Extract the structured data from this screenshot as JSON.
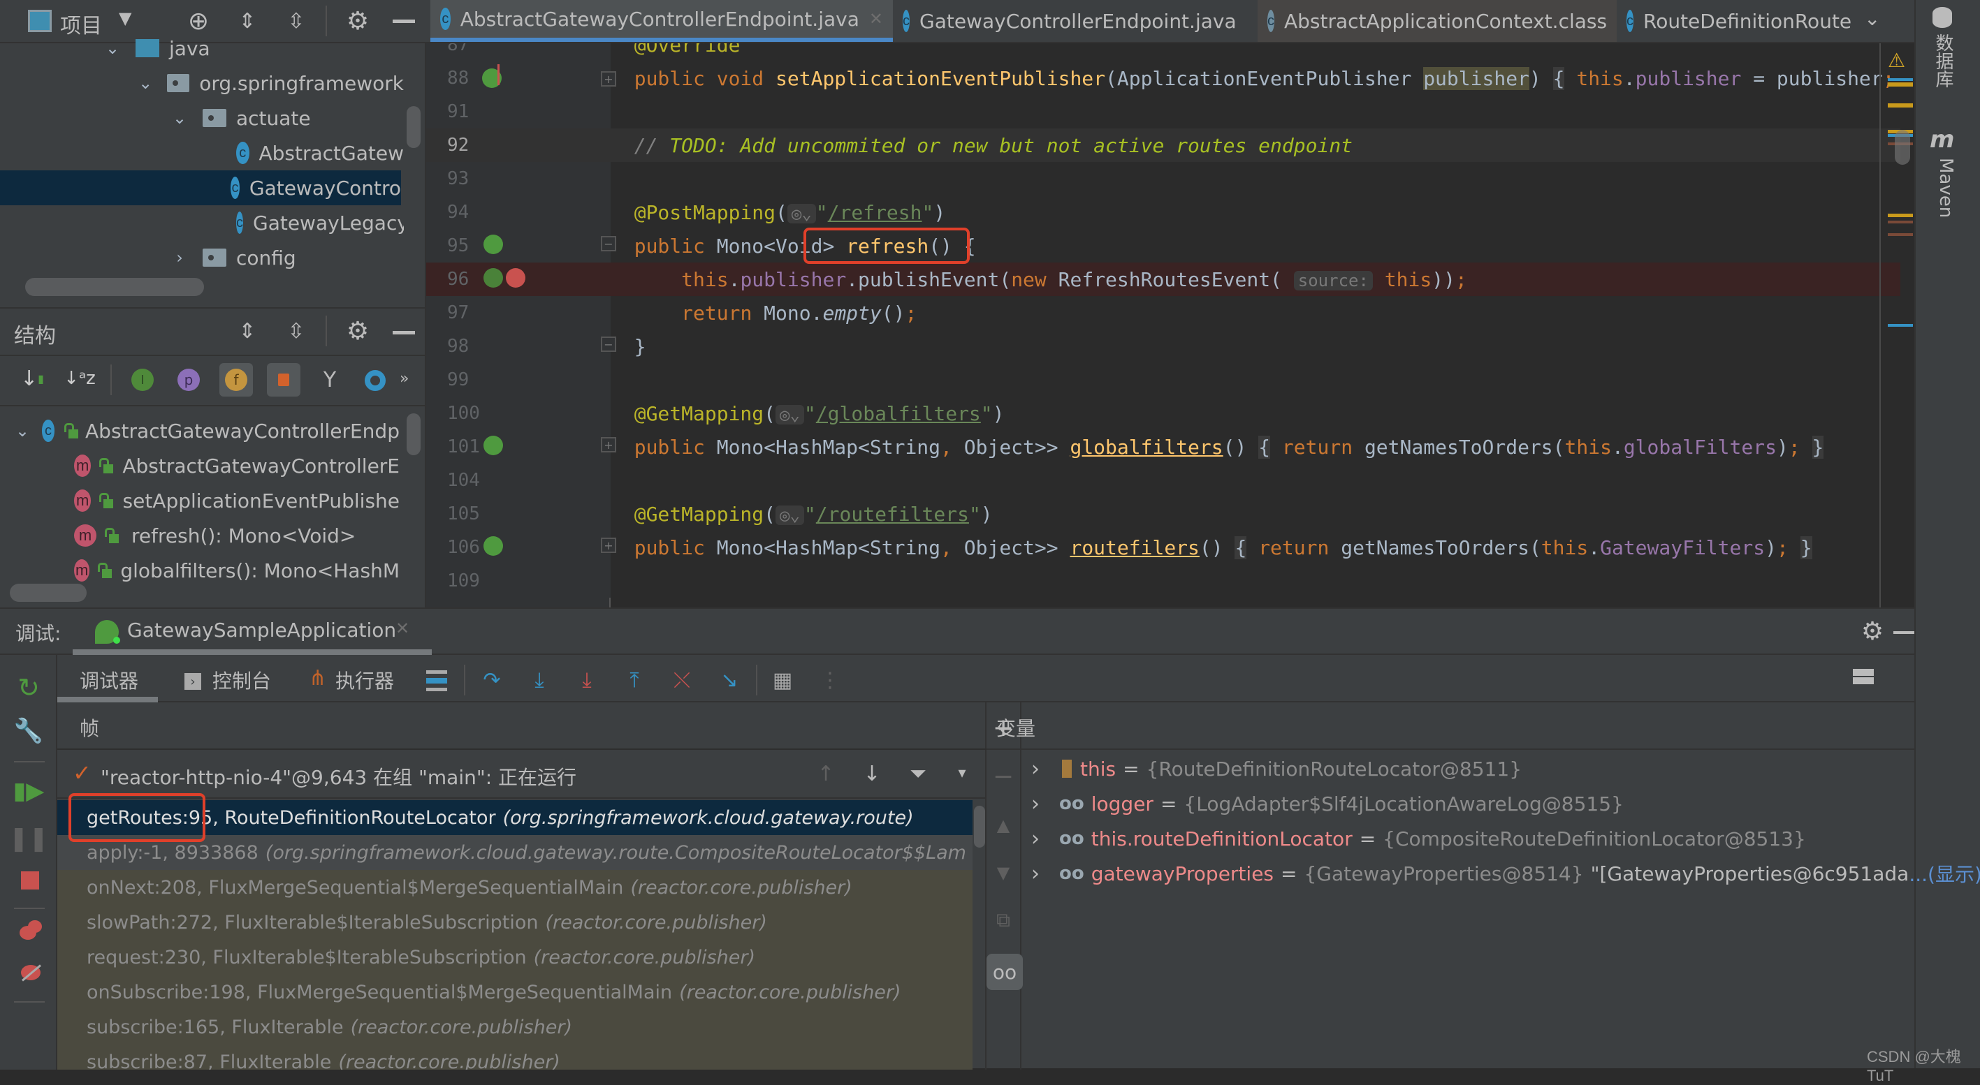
{
  "project_panel": {
    "title": "项目",
    "tree": [
      {
        "label": "java",
        "type": "source-folder",
        "expanded": true
      },
      {
        "label": "org.springframework",
        "type": "package",
        "expanded": true
      },
      {
        "label": "actuate",
        "type": "package",
        "expanded": true
      },
      {
        "label": "AbstractGatew",
        "type": "class"
      },
      {
        "label": "GatewayContro",
        "type": "class",
        "selected": true
      },
      {
        "label": "GatewayLegacy",
        "type": "class"
      },
      {
        "label": "config",
        "type": "package",
        "expanded": false
      }
    ]
  },
  "structure_panel": {
    "title": "结构",
    "toolbar_more": "»",
    "root": "AbstractGatewayControllerEndp",
    "members": [
      "AbstractGatewayControllerE",
      "setApplicationEventPublishe",
      "refresh(): Mono<Void>",
      "globalfilters(): Mono<HashM"
    ]
  },
  "tabs": [
    {
      "label": "AbstractGatewayControllerEndpoint.java",
      "active": true,
      "closable": true
    },
    {
      "label": "GatewayControllerEndpoint.java",
      "active": false,
      "closable": true
    },
    {
      "label": "AbstractApplicationContext.class",
      "active": false,
      "closable": true
    },
    {
      "label": "RouteDefinitionRoute",
      "active": false,
      "closable": false
    }
  ],
  "editor": {
    "lines": [
      {
        "num": "87",
        "html": "<span class='ann'>@Override</span>"
      },
      {
        "num": "88",
        "html": "<span class='kw'>public void </span><span class='fn'>setApplicationEventPublisher</span>(ApplicationEventPublisher <span style='background:#52503a'>publisher</span>) <span style='background:#3b3b3b'>{</span> <span class='kw'>this</span>.<span class='fld'>publisher</span> = publisher<span class='kw'>;</span> <span style='background:#3b3b3b'>}</span>"
      },
      {
        "num": "91",
        "html": ""
      },
      {
        "num": "92",
        "html": "<span class='cmt'>// </span><span class='todo'>TODO: Add uncommited or new but not active routes endpoint</span>",
        "current": true
      },
      {
        "num": "93",
        "html": ""
      },
      {
        "num": "94",
        "html": "<span class='ann'>@PostMapping</span>(<span class='hint'>◎⌄</span><span class='str'>\"<u>/refresh</u>\"</span>)"
      },
      {
        "num": "95",
        "html": "<span class='kw'>public </span>Mono&lt;Void&gt; <span class='fn'>refresh</span>() {"
      },
      {
        "num": "96",
        "html": "    <span class='kw'>this</span>.<span class='fld'>publisher</span>.publishEvent(<span class='kw'>new </span>RefreshRoutesEvent( <span class='hint'>source:</span> <span class='kw'>this</span>))<span class='kw'>;</span>",
        "breakpoint": true
      },
      {
        "num": "97",
        "html": "    <span class='kw'>return </span>Mono.<span class='ital'>empty</span>()<span class='kw'>;</span>"
      },
      {
        "num": "98",
        "html": "}"
      },
      {
        "num": "99",
        "html": ""
      },
      {
        "num": "100",
        "html": "<span class='ann'>@GetMapping</span>(<span class='hint'>◎⌄</span><span class='str'>\"<u>/globalfilters</u>\"</span>)"
      },
      {
        "num": "101",
        "html": "<span class='kw'>public </span>Mono&lt;HashMap&lt;String<span class='kw'>, </span>Object&gt;&gt; <span class='fn'><u>globalfilters</u></span>() <span style='background:#3b3b3b'>{</span> <span class='kw'>return </span>getNamesToOrders(<span class='kw'>this</span>.<span class='fld'>globalFilters</span>)<span class='kw'>;</span> <span style='background:#3b3b3b'>}</span>"
      },
      {
        "num": "104",
        "html": ""
      },
      {
        "num": "105",
        "html": "<span class='ann'>@GetMapping</span>(<span class='hint'>◎⌄</span><span class='str'>\"<u>/routefilters</u>\"</span>)"
      },
      {
        "num": "106",
        "html": "<span class='kw'>public </span>Mono&lt;HashMap&lt;String<span class='kw'>, </span>Object&gt;&gt; <span class='fn'><u>routefilers</u></span>() <span style='background:#3b3b3b'>{</span> <span class='kw'>return </span>getNamesToOrders(<span class='kw'>this</span>.<span class='fld'>GatewayFilters</span>)<span class='kw'>;</span> <span style='background:#3b3b3b'>}</span>"
      },
      {
        "num": "109",
        "html": ""
      }
    ]
  },
  "right_toolbar": {
    "database": "数据库",
    "maven": "Maven"
  },
  "debug": {
    "label": "调试:",
    "session": "GatewaySampleApplication",
    "tabs": [
      "调试器",
      "控制台",
      "执行器"
    ],
    "frames_title": "帧",
    "thread": "\"reactor-http-nio-4\"@9,643 在组 \"main\": 正在运行",
    "frames": [
      {
        "method": "getRoutes:95, RouteDefinitionRouteLocator",
        "pkg": "(org.springframework.cloud.gateway.route)",
        "state": "selected"
      },
      {
        "method": "apply:-1, 8933868",
        "pkg": "(org.springframework.cloud.gateway.route.CompositeRouteLocator$$Lam",
        "state": "normal"
      },
      {
        "method": "onNext:208, FluxMergeSequential$MergeSequentialMain",
        "pkg": "(reactor.core.publisher)",
        "state": "library"
      },
      {
        "method": "slowPath:272, FluxIterable$IterableSubscription",
        "pkg": "(reactor.core.publisher)",
        "state": "library"
      },
      {
        "method": "request:230, FluxIterable$IterableSubscription",
        "pkg": "(reactor.core.publisher)",
        "state": "library"
      },
      {
        "method": "onSubscribe:198, FluxMergeSequential$MergeSequentialMain",
        "pkg": "(reactor.core.publisher)",
        "state": "library"
      },
      {
        "method": "subscribe:165, FluxIterable",
        "pkg": "(reactor.core.publisher)",
        "state": "library"
      },
      {
        "method": "subscribe:87, FluxIterable",
        "pkg": "(reactor.core.publisher)",
        "state": "library"
      }
    ],
    "variables_title": "变量",
    "variables": [
      {
        "name": "this",
        "value": "{RouteDefinitionRouteLocator@8511}",
        "icon": "object"
      },
      {
        "name": "logger",
        "value": "{LogAdapter$Slf4jLocationAwareLog@8515}",
        "icon": "watch"
      },
      {
        "name": "this.routeDefinitionLocator",
        "value": "{CompositeRouteDefinitionLocator@8513}",
        "icon": "watch"
      },
      {
        "name": "gatewayProperties",
        "value": "{GatewayProperties@8514}",
        "string": "\"[GatewayProperties@6c951ada",
        "more": "...(显示)",
        "icon": "watch"
      }
    ]
  },
  "watermark": "CSDN @大槐TuT",
  "colors": {
    "accent": "#4a88c7",
    "selection": "#0d293e",
    "annotation_box": "#e0402a",
    "breakpoint_line": "#3a2323"
  }
}
